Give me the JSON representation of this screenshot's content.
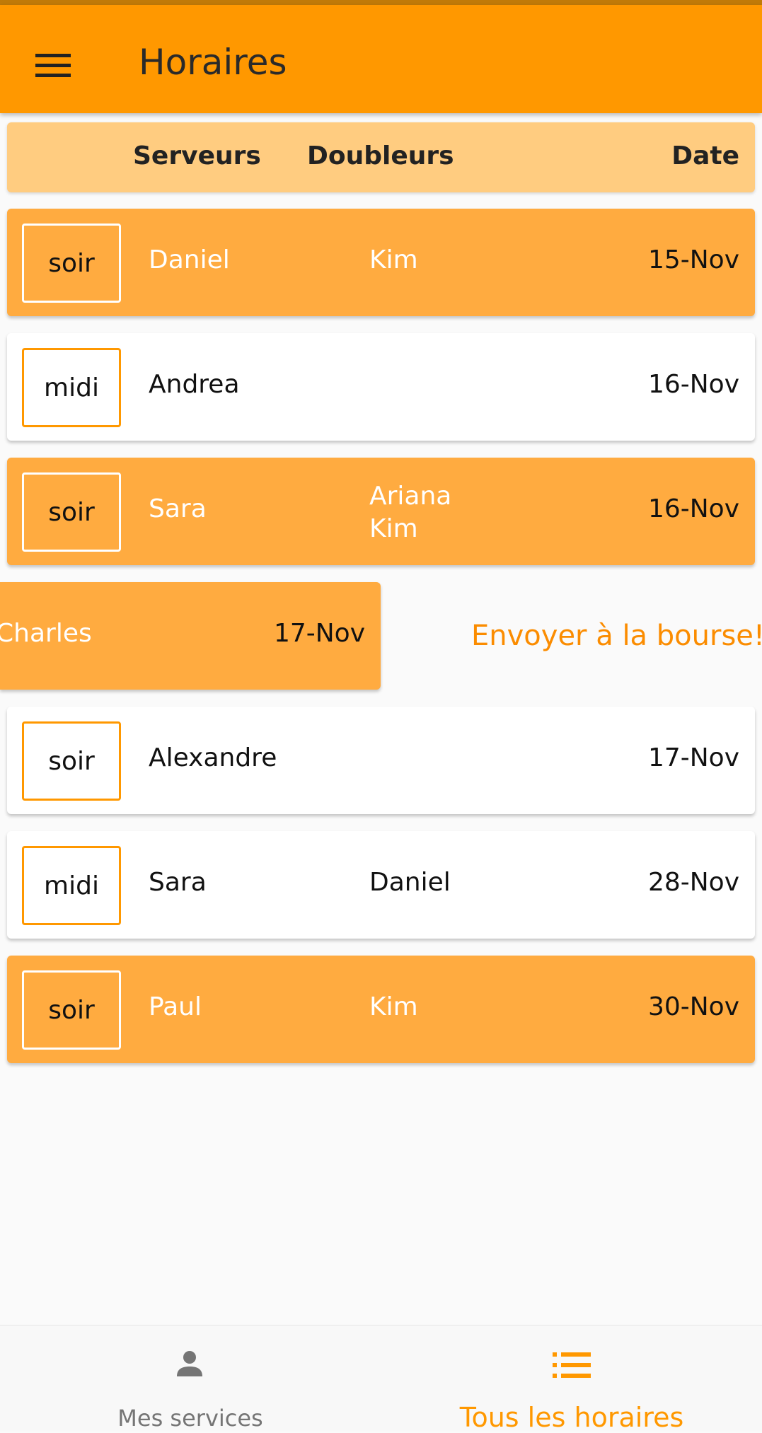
{
  "app_bar": {
    "title": "Horaires",
    "menu_icon": "menu-icon"
  },
  "table_header": {
    "servers": "Serveurs",
    "doublers": "Doubleurs",
    "date": "Date"
  },
  "rows": [
    {
      "shift": "soir",
      "server": "Daniel",
      "doublers": [
        "Kim"
      ],
      "date": "15-Nov",
      "style": "orange"
    },
    {
      "shift": "midi",
      "server": "Andrea",
      "doublers": [],
      "date": "16-Nov",
      "style": "white"
    },
    {
      "shift": "soir",
      "server": "Sara",
      "doublers": [
        "Ariana",
        "Kim"
      ],
      "date": "16-Nov",
      "style": "orange"
    },
    {
      "shift": "",
      "server": "Charles",
      "doublers": [],
      "date": "17-Nov",
      "style": "orange",
      "swiped": true
    },
    {
      "shift": "soir",
      "server": "Alexandre",
      "doublers": [],
      "date": "17-Nov",
      "style": "white"
    },
    {
      "shift": "midi",
      "server": "Sara",
      "doublers": [
        "Daniel"
      ],
      "date": "28-Nov",
      "style": "white"
    },
    {
      "shift": "soir",
      "server": "Paul",
      "doublers": [
        "Kim"
      ],
      "date": "30-Nov",
      "style": "orange"
    }
  ],
  "swipe_action": {
    "label": "Envoyer à la bourse!"
  },
  "bottom_nav": {
    "items": [
      {
        "label": "Mes services",
        "icon": "person-icon",
        "active": false
      },
      {
        "label": "Tous les horaires",
        "icon": "list-icon",
        "active": true
      }
    ]
  },
  "colors": {
    "primary": "#ff9800",
    "row_highlight": "#ffab40",
    "header_row": "#ffcc80",
    "accent_text": "#fb8c00"
  }
}
